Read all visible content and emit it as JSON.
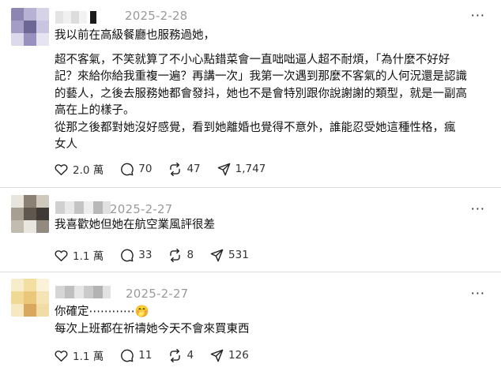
{
  "posts": [
    {
      "date": "2025-2-28",
      "more": "···",
      "paragraphs": [
        "我以前在高級餐廳也服務過她，",
        "超不客氣，不笑就算了不小心點錯菜會一直咄咄逼人超不耐煩，「為什麼不好好",
        "記？來給你給我重複一遍？再講一次」我第一次遇到那麼不客氣的人何況還是認識",
        "的藝人，之後去服務她都會發抖，她也不是會特別跟你說謝謝的類型，就是一副高",
        "高在上的樣子。",
        "從那之後都對她沒好感覺，看到她離婚也覺得不意外，誰能忍受她這種性格，瘋",
        "女人"
      ],
      "likes": "2.0 萬",
      "comments": "70",
      "reposts": "47",
      "shares": "1,747"
    },
    {
      "date": "2025-2-27",
      "more": "···",
      "paragraphs": [
        "我喜歡她但她在航空業風評很差"
      ],
      "likes": "1.1 萬",
      "comments": "33",
      "reposts": "8",
      "shares": "531"
    },
    {
      "date": "2025-2-27",
      "more": "···",
      "paragraphs": [
        "你確定⋯⋯⋯⋯🤭",
        "每次上班都在祈禱她今天不會來買東西"
      ],
      "likes": "1.1 萬",
      "comments": "11",
      "reposts": "4",
      "shares": "126"
    }
  ],
  "icons": {
    "like": "heart-icon",
    "comment": "comment-bubble-icon",
    "repost": "repost-arrows-icon",
    "share": "send-paper-plane-icon",
    "more": "more-dots-icon"
  },
  "colors": {
    "text": "#111111",
    "muted": "#9a9a9a",
    "divider": "#dcdcdc",
    "icon": "#222222"
  }
}
